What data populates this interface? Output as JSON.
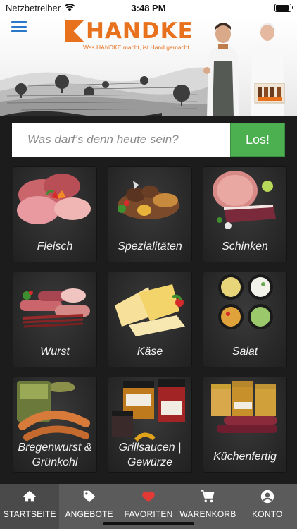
{
  "status_bar": {
    "carrier": "Netzbetreiber",
    "time": "3:48 PM",
    "wifi_icon": "wifi-icon",
    "battery_level": 0.9
  },
  "header": {
    "menu_icon": "hamburger-menu-icon",
    "logo_text": "HANDKE",
    "slogan": "Was HANDKE macht, ist Hand gemacht.",
    "brand_color": "#e8711d",
    "banner_illustration": "countryside-landscape",
    "banner_photo": "butcher-couple-with-products"
  },
  "search": {
    "placeholder": "Was darf's denn heute sein?",
    "button_label": "Los!",
    "button_color": "#4caf50"
  },
  "categories": [
    {
      "label": "Fleisch",
      "image": "raw-meat"
    },
    {
      "label": "Spezialitäten",
      "image": "schnitzel-and-meatballs"
    },
    {
      "label": "Schinken",
      "image": "ham"
    },
    {
      "label": "Wurst",
      "image": "sausages"
    },
    {
      "label": "Käse",
      "image": "cheese"
    },
    {
      "label": "Salat",
      "image": "salads"
    },
    {
      "label": "Bregenwurst & Grünkohl",
      "image": "bregenwurst-and-kale"
    },
    {
      "label": "Grillsaucen | Gewürze",
      "image": "sauce-jars"
    },
    {
      "label": "Küchenfertig",
      "image": "jars-and-sausages"
    }
  ],
  "bottom_nav": [
    {
      "label": "STARTSEITE",
      "icon": "home-icon",
      "active": true
    },
    {
      "label": "ANGEBOTE",
      "icon": "tag-icon",
      "active": false
    },
    {
      "label": "FAVORITEN",
      "icon": "heart-icon",
      "active": false
    },
    {
      "label": "WARENKORB",
      "icon": "cart-icon",
      "active": false
    },
    {
      "label": "KONTO",
      "icon": "account-icon",
      "active": false
    }
  ],
  "colors": {
    "nav_bg": "#5b5b5b",
    "favorite_heart": "#e53935",
    "menu_icon": "#2a79c9"
  }
}
